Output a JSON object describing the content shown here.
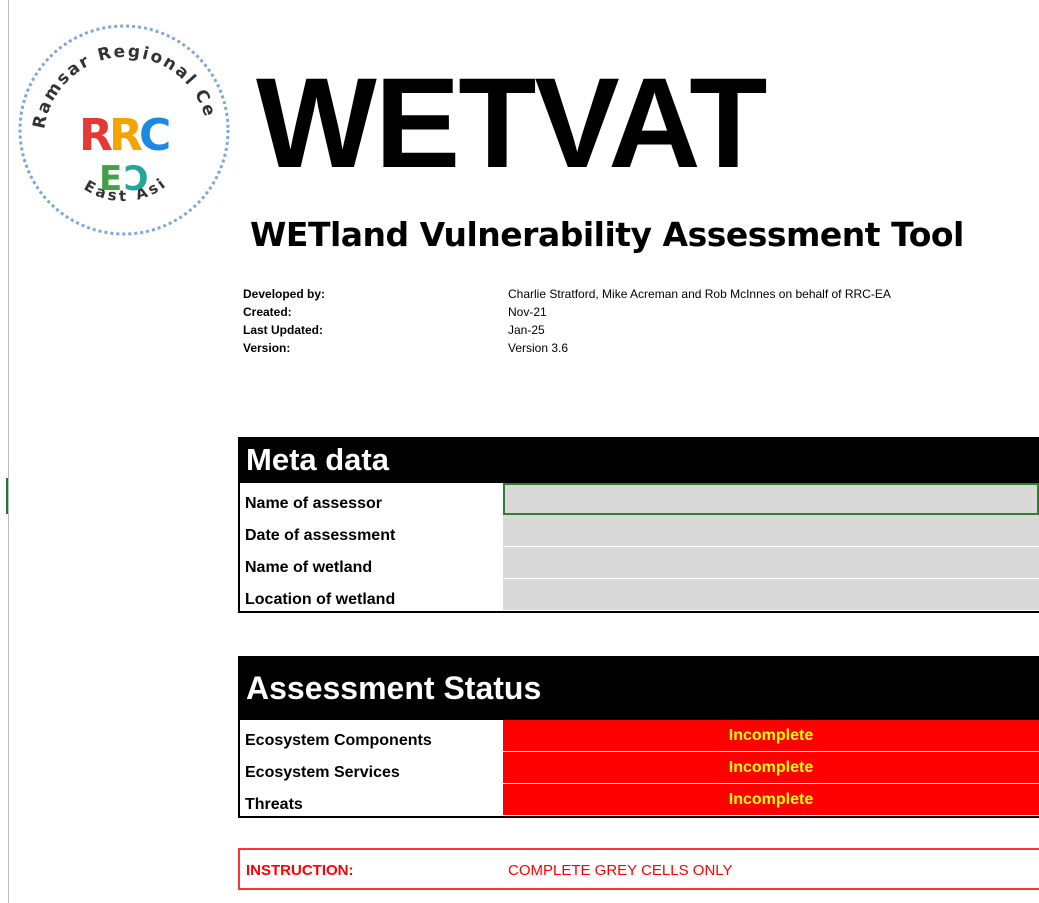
{
  "logo": {
    "ring_text_top": "Ramsar Regional Center",
    "ring_text_bottom": "East Asia",
    "mark_top": "RRC",
    "mark_bottom": "EA",
    "colors": {
      "ring": "#7fa8d6",
      "r1": "#e53935",
      "r2": "#f4a300",
      "c": "#1e88e5",
      "e": "#43a047",
      "a": "#26a69a"
    }
  },
  "title": "WETVAT",
  "subtitle": "WETland Vulnerability Assessment Tool",
  "info": [
    {
      "key": "Developed by:",
      "value": "Charlie Stratford, Mike Acreman and Rob McInnes on behalf of RRC-EA"
    },
    {
      "key": "Created:",
      "value": "Nov-21"
    },
    {
      "key": "Last Updated:",
      "value": "Jan-25"
    },
    {
      "key": "Version:",
      "value": "Version 3.6"
    }
  ],
  "meta": {
    "header": "Meta data",
    "rows": [
      {
        "label": "Name of assessor",
        "value": ""
      },
      {
        "label": "Date of assessment",
        "value": ""
      },
      {
        "label": "Name of wetland",
        "value": ""
      },
      {
        "label": "Location of wetland",
        "value": ""
      }
    ]
  },
  "status": {
    "header": "Assessment Status",
    "rows": [
      {
        "label": "Ecosystem Components",
        "value": "Incomplete"
      },
      {
        "label": "Ecosystem Services",
        "value": "Incomplete"
      },
      {
        "label": "Threats",
        "value": "Incomplete"
      }
    ],
    "colors": {
      "fill": "#ff0000",
      "text": "#ffff00"
    }
  },
  "instruction": {
    "key": "INSTRUCTION:",
    "value": "COMPLETE GREY CELLS ONLY"
  }
}
